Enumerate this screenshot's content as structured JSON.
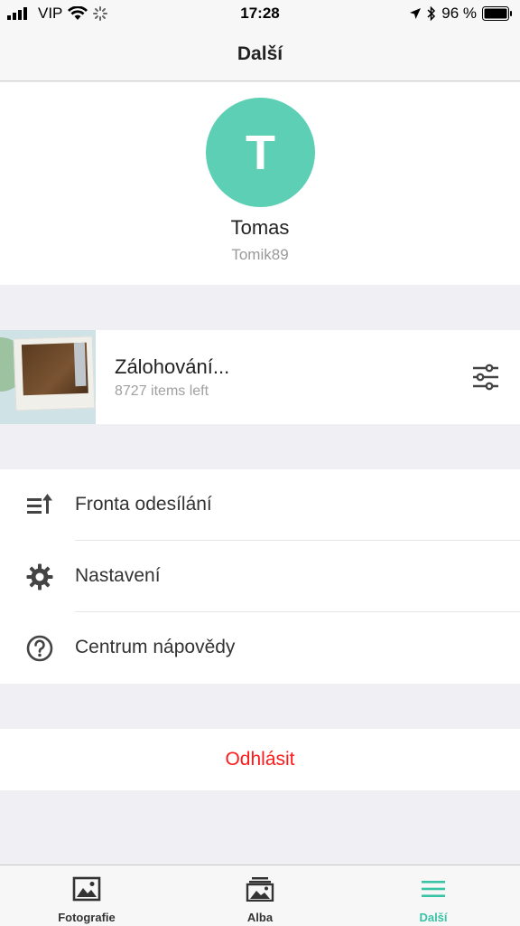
{
  "status_bar": {
    "carrier": "VIP",
    "time": "17:28",
    "battery": "96 %"
  },
  "nav": {
    "title": "Další"
  },
  "profile": {
    "initial": "T",
    "name": "Tomas",
    "username": "Tomik89",
    "avatar_color": "#5ccfb5"
  },
  "backup": {
    "title": "Zálohování...",
    "subtitle": "8727 items left",
    "settings_icon": "sliders-icon"
  },
  "menu": {
    "items": [
      {
        "label": "Fronta odesílání",
        "icon": "upload-queue-icon"
      },
      {
        "label": "Nastavení",
        "icon": "gear-icon"
      },
      {
        "label": "Centrum nápovědy",
        "icon": "help-circle-icon"
      }
    ]
  },
  "logout": {
    "label": "Odhlásit",
    "color": "#ff1a1a"
  },
  "tabs": {
    "items": [
      {
        "label": "Fotografie",
        "icon": "photo-icon"
      },
      {
        "label": "Alba",
        "icon": "albums-icon"
      },
      {
        "label": "Další",
        "icon": "menu-icon",
        "active": true
      }
    ],
    "accent": "#38c3a5"
  }
}
